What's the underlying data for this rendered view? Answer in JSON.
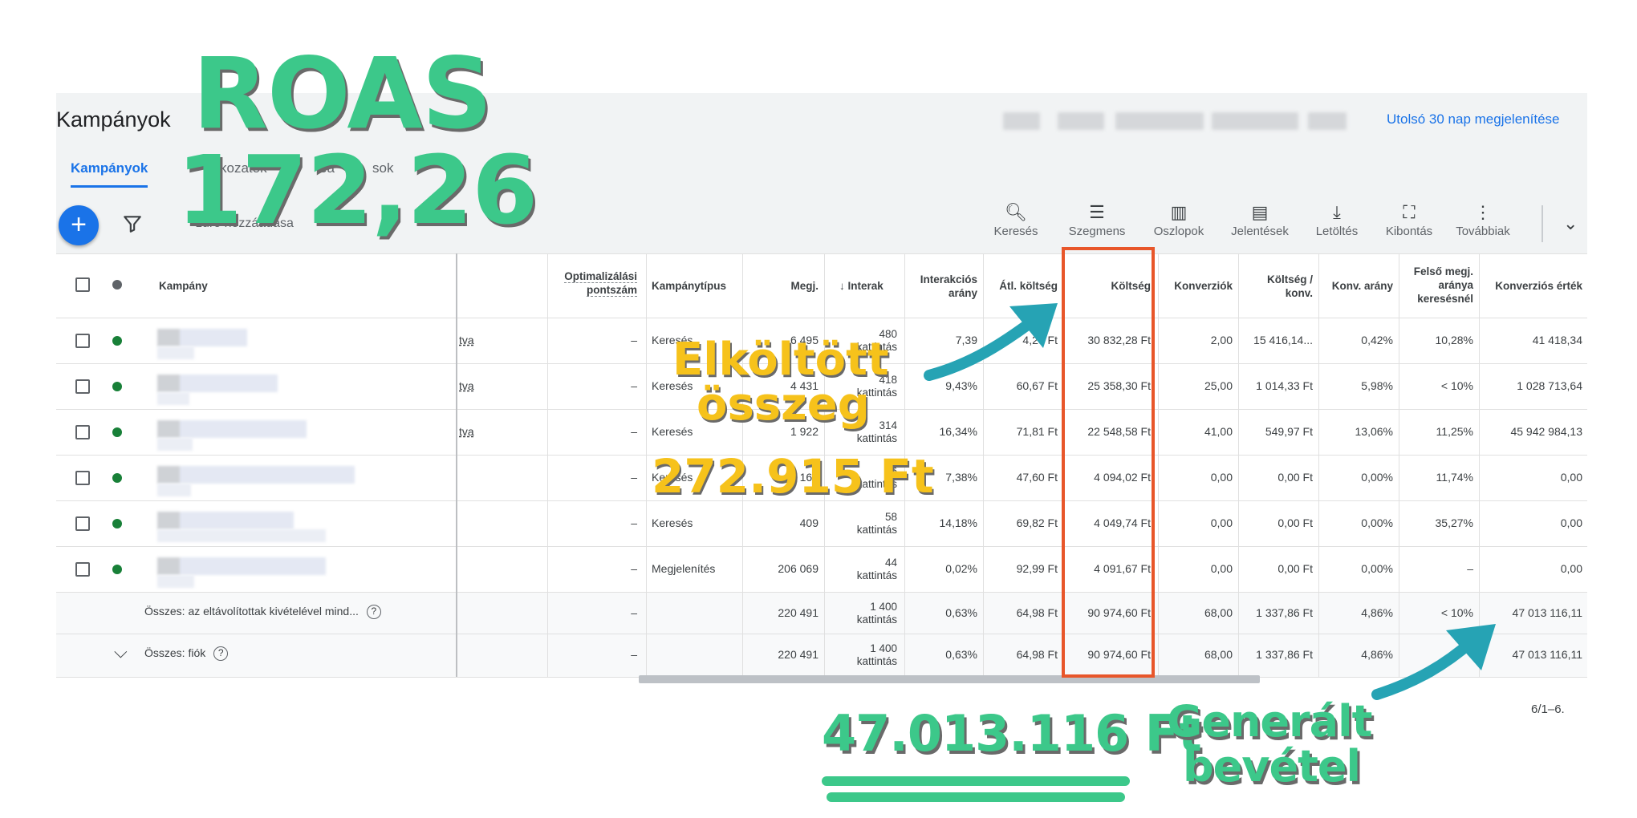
{
  "app": {
    "title": "Kampányok",
    "date_range_link": "Utolsó 30 nap megjelenítése"
  },
  "tabs": [
    {
      "label": "Kampányok"
    },
    {
      "label": "kozatok"
    },
    {
      "label": "ea"
    },
    {
      "label": "sok"
    }
  ],
  "toolbar": {
    "filter_text": "zűrő hozzáadása",
    "tools": [
      {
        "label": "Keresés",
        "icon": "search-icon"
      },
      {
        "label": "Szegmens",
        "icon": "segment-icon"
      },
      {
        "label": "Oszlopok",
        "icon": "columns-icon"
      },
      {
        "label": "Jelentések",
        "icon": "reports-icon"
      },
      {
        "label": "Letöltés",
        "icon": "download-icon"
      },
      {
        "label": "Kibontás",
        "icon": "expand-icon"
      },
      {
        "label": "Továbbiak",
        "icon": "more-icon"
      }
    ]
  },
  "table": {
    "headers": {
      "campaign": "Kampány",
      "opt_score": "Optimalizálási pontszám",
      "type": "Kampánytípus",
      "impr": "Megj.",
      "interactions": "↓ Interak",
      "int_rate": "Interakciós arány",
      "avg_cost": "Átl. költség",
      "cost": "Költség",
      "conversions": "Konverziók",
      "cost_per_conv": "Költség / konv.",
      "conv_rate": "Konv. arány",
      "top_impr": "Felső megj. aránya keresésnél",
      "conv_value": "Konverziós érték"
    },
    "rows": [
      {
        "status_text": "tva",
        "opt": "–",
        "type": "Keresés",
        "impr": "6 495",
        "int_num": "480",
        "int_unit": "kattintás",
        "int_rate": "7,39",
        "avg_cost": "4,23 Ft",
        "cost": "30 832,28 Ft",
        "conv": "2,00",
        "cpc": "15 416,14...",
        "cr": "0,42%",
        "top": "10,28%",
        "value": "41 418,34"
      },
      {
        "status_text": "tva",
        "opt": "–",
        "type": "Keresés",
        "impr": "4 431",
        "int_num": "418",
        "int_unit": "kattintás",
        "int_rate": "9,43%",
        "avg_cost": "60,67 Ft",
        "cost": "25 358,30 Ft",
        "conv": "25,00",
        "cpc": "1 014,33 Ft",
        "cr": "5,98%",
        "top": "< 10%",
        "value": "1 028 713,64"
      },
      {
        "status_text": "tva",
        "opt": "–",
        "type": "Keresés",
        "impr": "1 922",
        "int_num": "314",
        "int_unit": "kattintás",
        "int_rate": "16,34%",
        "avg_cost": "71,81 Ft",
        "cost": "22 548,58 Ft",
        "conv": "41,00",
        "cpc": "549,97 Ft",
        "cr": "13,06%",
        "top": "11,25%",
        "value": "45 942 984,13"
      },
      {
        "status_text": "",
        "opt": "–",
        "type": "Keresés",
        "impr": "1 165",
        "int_num": "86",
        "int_unit": "kattintás",
        "int_rate": "7,38%",
        "avg_cost": "47,60 Ft",
        "cost": "4 094,02 Ft",
        "conv": "0,00",
        "cpc": "0,00 Ft",
        "cr": "0,00%",
        "top": "11,74%",
        "value": "0,00"
      },
      {
        "status_text": "",
        "opt": "–",
        "type": "Keresés",
        "impr": "409",
        "int_num": "58",
        "int_unit": "kattintás",
        "int_rate": "14,18%",
        "avg_cost": "69,82 Ft",
        "cost": "4 049,74 Ft",
        "conv": "0,00",
        "cpc": "0,00 Ft",
        "cr": "0,00%",
        "top": "35,27%",
        "value": "0,00"
      },
      {
        "status_text": "",
        "opt": "–",
        "type": "Megjelenítés",
        "impr": "206 069",
        "int_num": "44",
        "int_unit": "kattintás",
        "int_rate": "0,02%",
        "avg_cost": "92,99 Ft",
        "cost": "4 091,67 Ft",
        "conv": "0,00",
        "cpc": "0,00 Ft",
        "cr": "0,00%",
        "top": "–",
        "value": "0,00"
      }
    ],
    "totals": [
      {
        "label": "Összes: az eltávolítottak kivételével mind...",
        "opt": "–",
        "impr": "220 491",
        "int_num": "1 400",
        "int_unit": "kattintás",
        "int_rate": "0,63%",
        "avg_cost": "64,98 Ft",
        "cost": "90 974,60 Ft",
        "conv": "68,00",
        "cpc": "1 337,86 Ft",
        "cr": "4,86%",
        "top": "< 10%",
        "value": "47 013 116,11"
      },
      {
        "label": "Összes: fiók",
        "opt": "–",
        "impr": "220 491",
        "int_num": "1 400",
        "int_unit": "kattintás",
        "int_rate": "0,63%",
        "avg_cost": "64,98 Ft",
        "cost": "90 974,60 Ft",
        "conv": "68,00",
        "cpc": "1 337,86 Ft",
        "cr": "4,86%",
        "top": "",
        "value": "47 013 116,11"
      }
    ],
    "pagination": "6/1–6."
  },
  "annotations": {
    "roas_label": "ROAS",
    "roas_value": "172,26",
    "spent_label_1": "Elköltött",
    "spent_label_2": "összeg",
    "spent_value": "272.915 Ft",
    "revenue_value": "47.013.116 Ft",
    "revenue_label_1": "Generált",
    "revenue_label_2": "bevétel"
  },
  "colors": {
    "accent": "#1a73e8",
    "annotation_green": "#3cc88a",
    "annotation_yellow": "#f6c21b",
    "arrow_teal": "#26a3b4",
    "highlight_box": "#e8562a",
    "status_enabled": "#188038"
  }
}
